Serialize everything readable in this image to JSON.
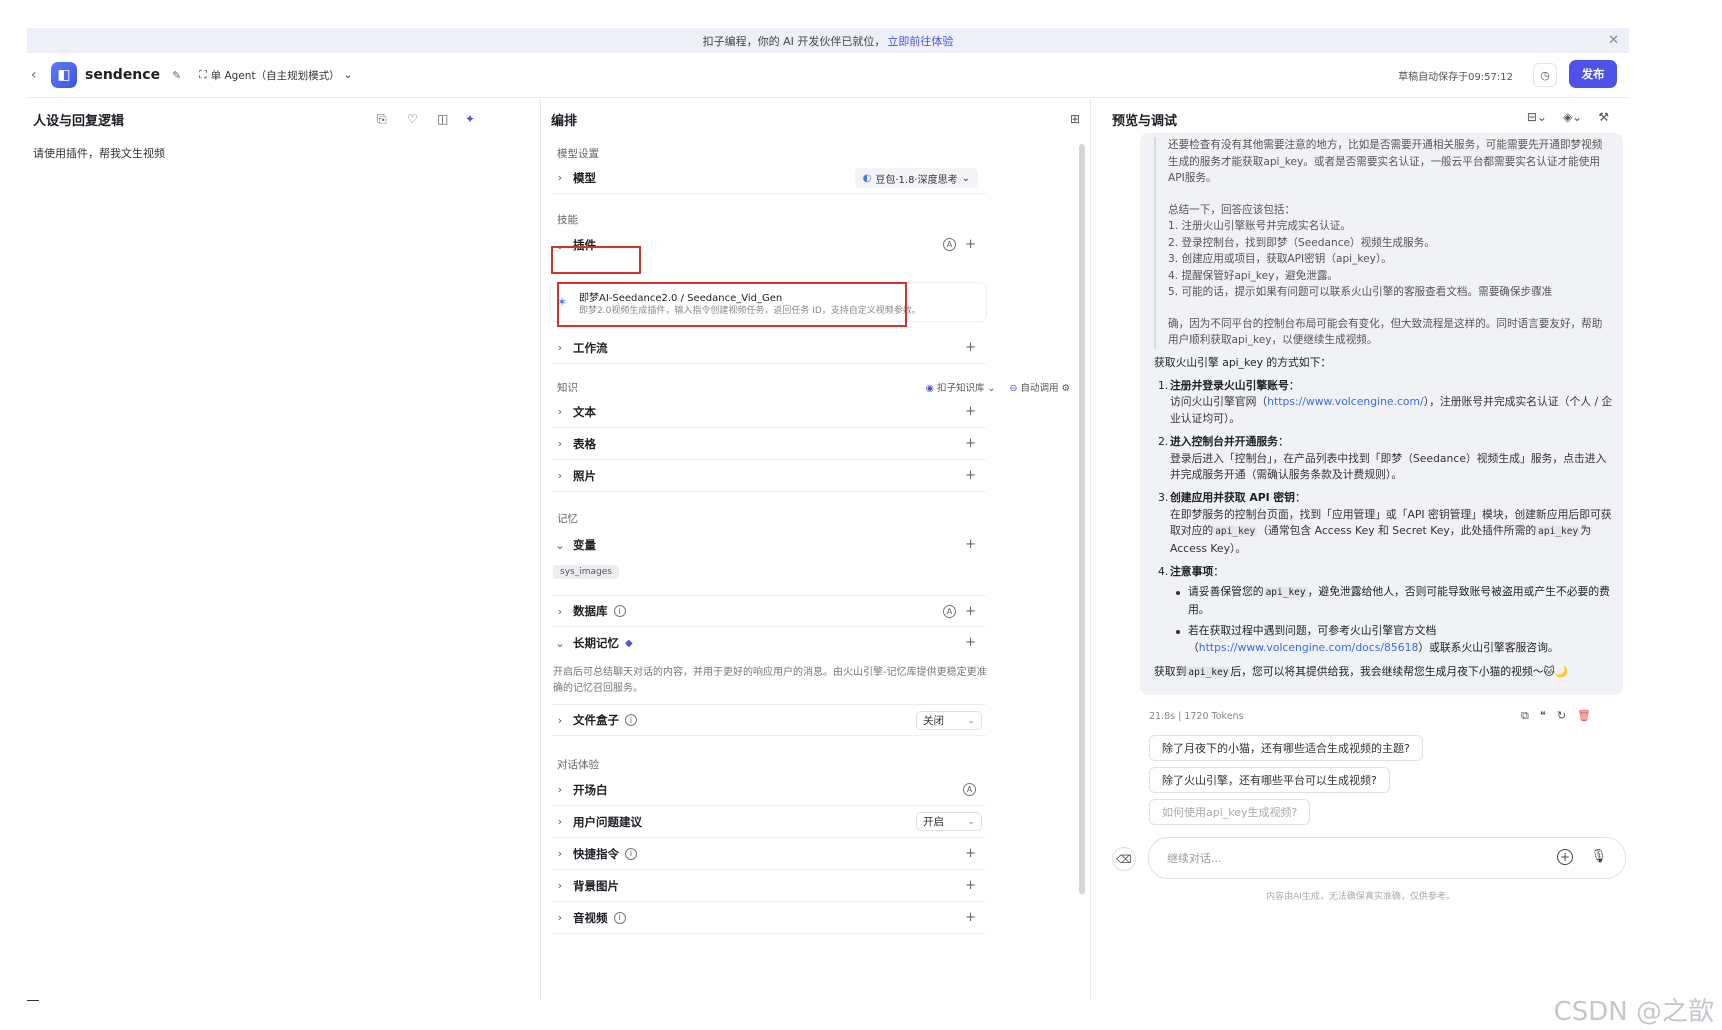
{
  "banner": {
    "text": "扣子编程，你的 AI 开发伙伴已就位，",
    "link": "立即前往体验"
  },
  "header": {
    "app_name": "sendence",
    "agent_mode": "单 Agent（自主规划模式）",
    "saved_text": "草稿自动保存于09:57:12",
    "publish": "发布"
  },
  "persona": {
    "title": "人设与回复逻辑",
    "prompt": "请使用插件，帮我文生视频"
  },
  "arrange": {
    "title": "编排",
    "model_section": "模型设置",
    "model_label": "模型",
    "model_value": "豆包·1.8·深度思考",
    "skills_section": "技能",
    "plugin_label": "插件",
    "plugin_name": "即梦AI-Seedance2.0 / Seedance_Vid_Gen",
    "plugin_desc": "即梦2.0视频生成插件，输入指令创建视频任务，返回任务 ID，支持自定义视频参数。",
    "workflow_label": "工作流",
    "knowledge_section": "知识",
    "kb_source": "扣子知识库",
    "auto_call": "自动调用",
    "text_label": "文本",
    "table_label": "表格",
    "photo_label": "照片",
    "memory_section": "记忆",
    "variable_label": "变量",
    "variable_tag": "sys_images",
    "db_label": "数据库",
    "ltm_label": "长期记忆",
    "ltm_desc": "开启后可总结聊天对话的内容，并用于更好的响应用户的消息。由火山引擎-记忆库提供更稳定更准确的记忆召回服务。",
    "filebox_label": "文件盒子",
    "filebox_value": "关闭",
    "dialog_section": "对话体验",
    "opening_label": "开场白",
    "suggest_label": "用户问题建议",
    "suggest_value": "开启",
    "shortcut_label": "快捷指令",
    "bg_label": "背景图片",
    "av_label": "音视频"
  },
  "preview": {
    "title": "预览与调试",
    "think": [
      "还要检查有没有其他需要注意的地方，比如是否需要开通相关服务，可能需要先开通即梦视频生成的服务才能获取api_key。或者是否需要实名认证，一般云平台都需要实名认证才能使用API服务。",
      "总结一下，回答应该包括：",
      "1. 注册火山引擎账号并完成实名认证。",
      "2. 登录控制台，找到即梦（Seedance）视频生成服务。",
      "3. 创建应用或项目，获取API密钥（api_key）。",
      "4. 提醒保管好api_key，避免泄露。",
      "5. 可能的话，提示如果有问题可以联系火山引擎的客服查看文档。需要确保步骤准",
      "确，因为不同平台的控制台布局可能会有变化，但大致流程是这样的。同时语言要友好，帮助用户顺利获取api_key，以便继续生成视频。"
    ],
    "answer_intro": "获取火山引擎 api_key 的方式如下：",
    "s1_title": "注册并登录火山引擎账号",
    "s1_pre": "访问火山引擎官网（",
    "s1_link": "https://www.volcengine.com/",
    "s1_post": "），注册账号并完成实名认证（个人 / 企业认证均可）。",
    "s2_title": "进入控制台并开通服务",
    "s2_text": "登录后进入「控制台」，在产品列表中找到「即梦（Seedance）视频生成」服务，点击进入并完成服务开通（需确认服务条款及计费规则）。",
    "s3_title": "创建应用并获取 API 密钥",
    "s3_pre": "在即梦服务的控制台页面，找到「应用管理」或「API 密钥管理」模块，创建新应用后即可获取对应的",
    "s3_code": "api_key",
    "s3_mid": "（通常包含 Access Key 和 Secret Key，此处插件所需的",
    "s3_code2": "api_key",
    "s3_post": "为 Access Key）。",
    "s4_title": "注意事项",
    "b1_pre": "请妥善保管您的",
    "b1_code": "api_key",
    "b1_post": "，避免泄露给他人，否则可能导致账号被盗用或产生不必要的费用。",
    "b2_pre": "若在获取过程中遇到问题，可参考火山引擎官方文档（",
    "b2_link": "https://www.volcengine.com/docs/85618",
    "b2_post": "）或联系火山引擎客服咨询。",
    "closing_pre": "获取到",
    "closing_code": "api_key",
    "closing_post": "后，您可以将其提供给我，我会继续帮您生成月夜下小猫的视频～🐱🌙",
    "meta": "21.8s | 1720 Tokens",
    "suggestions": [
      "除了月夜下的小猫，还有哪些适合生成视频的主题?",
      "除了火山引擎，还有哪些平台可以生成视频?",
      "如何使用api_key生成视频?"
    ],
    "input_placeholder": "继续对话...",
    "disclaimer": "内容由AI生成，无法确保真实准确，仅供参考。"
  },
  "watermark": "CSDN @之歆",
  "colors": {
    "accent": "#4d53e8",
    "highlight": "#d9302b",
    "link": "#3a6ae8"
  }
}
